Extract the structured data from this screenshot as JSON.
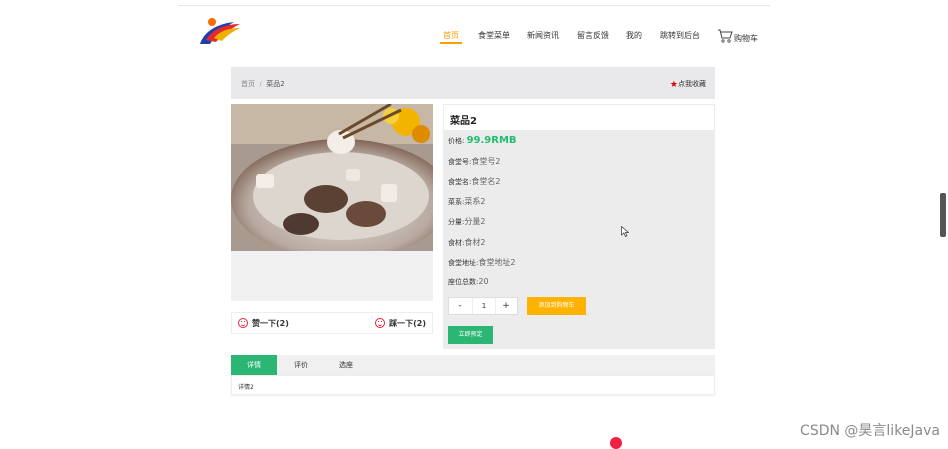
{
  "header": {
    "nav": [
      {
        "label": "首页",
        "active": true
      },
      {
        "label": "食堂菜单"
      },
      {
        "label": "新闻资讯"
      },
      {
        "label": "留言反馈"
      },
      {
        "label": "我的"
      },
      {
        "label": "跳转到后台"
      },
      {
        "label": "购物车",
        "icon": "cart-icon"
      }
    ],
    "accent_color": "#ff9c00"
  },
  "breadcrumb": {
    "home": "首页",
    "separator": "/",
    "current": "菜品2"
  },
  "favorite": {
    "label": "点我收藏",
    "icon": "star-icon"
  },
  "reactions": {
    "like_label": "赞一下(2)",
    "dislike_label": "踩一下(2)"
  },
  "product": {
    "title": "菜品2",
    "price_label": "价格:",
    "price": "99.9RMB",
    "fields": [
      {
        "label": "食堂号:",
        "value": "食堂号2"
      },
      {
        "label": "食堂名:",
        "value": "食堂名2"
      },
      {
        "label": "菜系:",
        "value": "菜系2"
      },
      {
        "label": "分量:",
        "value": "分量2"
      },
      {
        "label": "食材:",
        "value": "食材2"
      },
      {
        "label": "食堂地址:",
        "value": "食堂地址2"
      },
      {
        "label": "座位总数:",
        "value": "20"
      }
    ],
    "quantity": {
      "minus": "-",
      "value": "1",
      "plus": "+"
    },
    "add_to_cart": "添加到购物车",
    "book_now": "立即预定",
    "price_color": "#1fbf6d"
  },
  "tabs": [
    {
      "label": "详情",
      "active": true
    },
    {
      "label": "评价"
    },
    {
      "label": "选座"
    }
  ],
  "tab_content": "详情2",
  "watermark": "CSDN @昊言likeJava"
}
